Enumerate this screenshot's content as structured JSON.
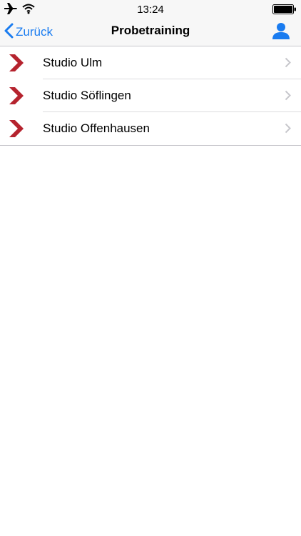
{
  "status_bar": {
    "time": "13:24",
    "icons": [
      "airplane-icon",
      "wifi-icon",
      "battery-icon"
    ]
  },
  "nav": {
    "back_label": "Zurück",
    "title": "Probetraining",
    "profile_icon": "person-icon",
    "accent_color": "#1a7cf0"
  },
  "studios": {
    "icon": "red-chevron-icon",
    "icon_color": "#b5232e",
    "items": [
      {
        "label": "Studio Ulm"
      },
      {
        "label": "Studio Söflingen"
      },
      {
        "label": "Studio Offenhausen"
      }
    ]
  }
}
